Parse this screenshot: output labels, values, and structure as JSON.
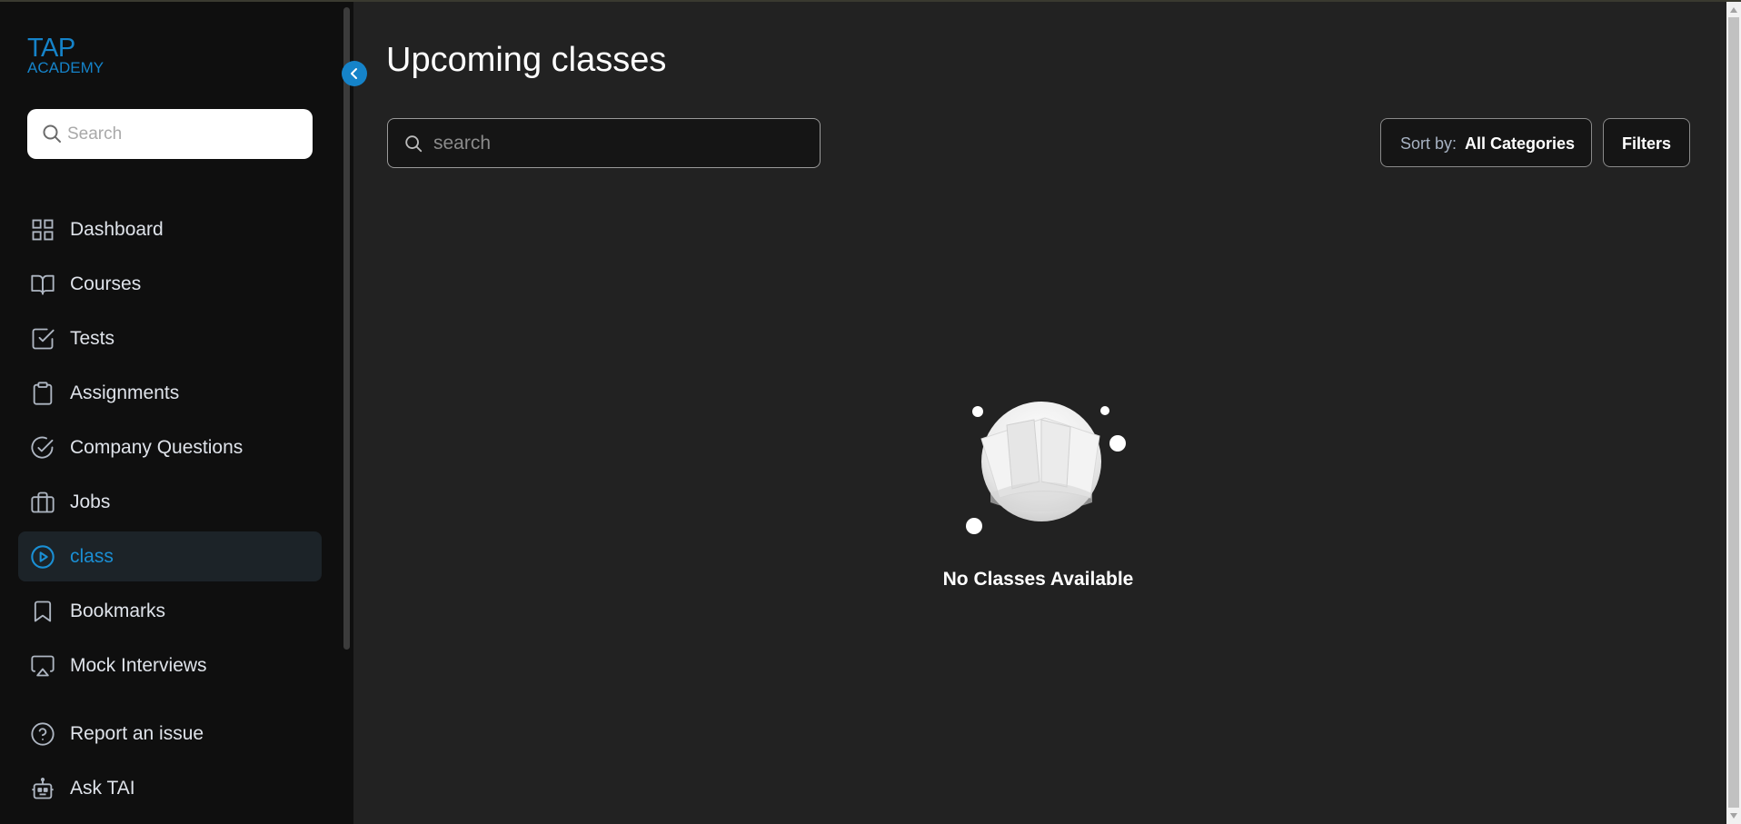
{
  "app": {
    "logo_line1": "TAP",
    "logo_line2": "ACADEMY",
    "brand_color": "#1583c9",
    "active_color": "#1a8fd4"
  },
  "sidebar": {
    "search_placeholder": "Search",
    "items": [
      {
        "label": "Dashboard",
        "icon": "grid-icon"
      },
      {
        "label": "Courses",
        "icon": "book-open-icon"
      },
      {
        "label": "Tests",
        "icon": "check-square-icon"
      },
      {
        "label": "Assignments",
        "icon": "clipboard-icon"
      },
      {
        "label": "Company Questions",
        "icon": "check-circle-icon"
      },
      {
        "label": "Jobs",
        "icon": "briefcase-icon"
      },
      {
        "label": "class",
        "icon": "play-circle-icon",
        "active": true
      },
      {
        "label": "Bookmarks",
        "icon": "bookmark-icon"
      },
      {
        "label": "Mock Interviews",
        "icon": "airplay-icon"
      }
    ],
    "footer_items": [
      {
        "label": "Report an issue",
        "icon": "help-circle-icon"
      },
      {
        "label": "Ask TAI",
        "icon": "robot-icon"
      }
    ]
  },
  "main": {
    "title": "Upcoming classes",
    "search_placeholder": "search",
    "sort_label": "Sort by:",
    "sort_value": "All Categories",
    "filters_label": "Filters",
    "empty_message": "No Classes Available"
  }
}
